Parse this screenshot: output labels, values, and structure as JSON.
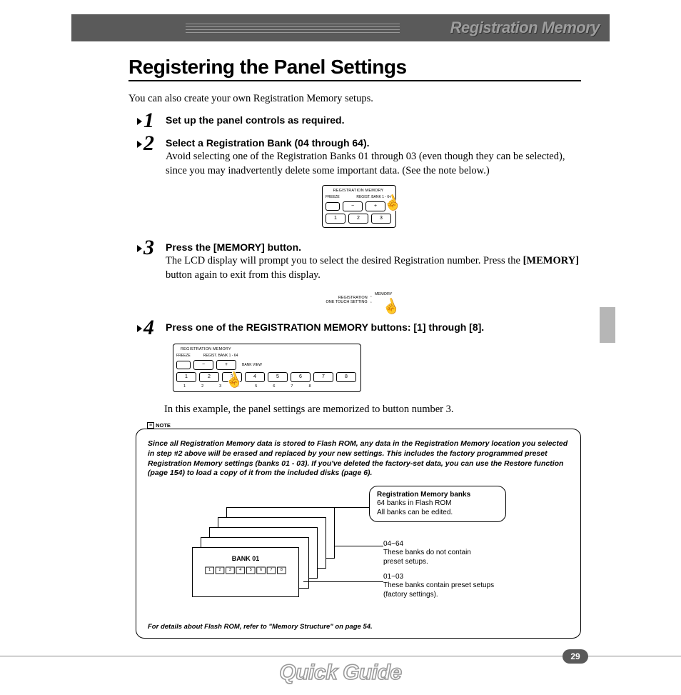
{
  "header": {
    "chapter": "Registration Memory"
  },
  "title": "Registering the Panel Settings",
  "intro": "You can also create your own Registration Memory setups.",
  "steps": [
    {
      "num": "1",
      "title": "Set up the panel controls as required.",
      "body": ""
    },
    {
      "num": "2",
      "title": "Select a Registration Bank (04 through 64).",
      "body": "Avoid selecting one of the Registration Banks 01 through 03 (even though they can be selected), since you may inadvertently delete some important data. (See the note below.)"
    },
    {
      "num": "3",
      "title": "Press the [MEMORY] button.",
      "body_pre": "The LCD display will prompt you to select the desired Registration number. Press the ",
      "body_bold": "[MEMORY]",
      "body_post": " button again to exit from this display."
    },
    {
      "num": "4",
      "title": "Press one of the REGISTRATION MEMORY buttons: [1] through [8].",
      "body": ""
    }
  ],
  "diag_labels": {
    "reg_mem": "REGISTRATION MEMORY",
    "freeze": "FREEZE",
    "regist_bank": "REGIST. BANK 1 - 64",
    "memory": "MEMORY",
    "registration": "REGISTRATION",
    "ots": "ONE TOUCH SETTING",
    "bank_view": "BANK VIEW",
    "btn_minus": "−",
    "btn_plus": "+",
    "nums3": [
      "1",
      "2",
      "3"
    ],
    "nums8": [
      "1",
      "2",
      "3",
      "4",
      "5",
      "6",
      "7",
      "8"
    ]
  },
  "closing": "In this example, the panel settings are memorized to button number 3.",
  "note": {
    "badge": "NOTE",
    "main": "Since all Registration Memory data is stored to Flash ROM, any data in the Registration Memory location you selected in step #2 above will be erased and replaced by your new settings. This includes the factory programmed preset Registration Memory settings (banks 01 - 03). If you've deleted the factory-set data, you can use the Restore function (page 154) to load a copy of it from the included disks (page 6).",
    "bank_label": "BANK 01",
    "reg_cells": [
      "1",
      "2",
      "3",
      "4",
      "5",
      "6",
      "7",
      "8"
    ],
    "callout1_title": "Registration Memory banks",
    "callout1_l1": "64 banks in Flash ROM",
    "callout1_l2": "All banks can be edited.",
    "callout2_title": "04~64",
    "callout2_body": "These banks do not contain preset setups.",
    "callout3_title": "01~03",
    "callout3_body": "These banks contain preset setups (factory settings).",
    "foot": "For details about Flash ROM, refer to \"Memory Structure\" on page 54."
  },
  "footer": {
    "brand": "Quick Guide",
    "page": "29"
  }
}
